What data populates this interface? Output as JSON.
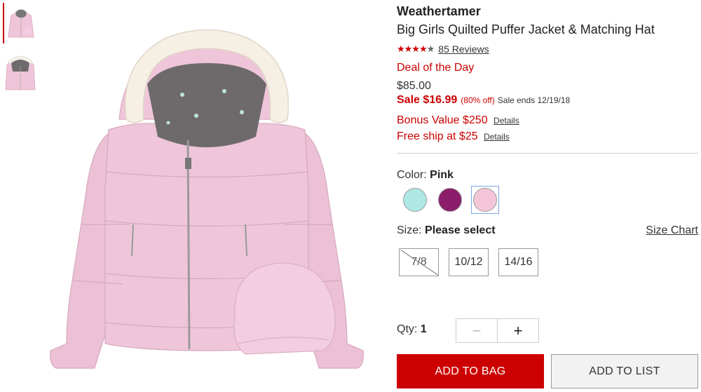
{
  "product": {
    "brand": "Weathertamer",
    "title": "Big Girls Quilted Puffer Jacket & Matching Hat",
    "rating_stars": "★★★★",
    "rating_empty_star": "★",
    "reviews_label": "85 Reviews",
    "deal_label": "Deal of the Day",
    "regular_price": "$85.00",
    "sale_price": "Sale $16.99",
    "sale_off": "(80% off)",
    "sale_ends": "Sale ends 12/19/18",
    "bonus_text": "Bonus Value $250",
    "ship_text": "Free ship at $25",
    "details_label": "Details"
  },
  "thumbnails": [
    {
      "icon": "jacket-front-thumbnail"
    },
    {
      "icon": "jacket-lining-thumbnail"
    }
  ],
  "color": {
    "label": "Color:",
    "selected": "Pink",
    "swatches": [
      {
        "name": "aqua",
        "color": "#aee8e4"
      },
      {
        "name": "purple",
        "color": "#8b1d6b"
      },
      {
        "name": "pink",
        "color": "#f4c6d8"
      }
    ]
  },
  "size": {
    "label": "Size:",
    "selected": "Please select",
    "chart_label": "Size Chart",
    "options": [
      {
        "label": "7/8",
        "available": false
      },
      {
        "label": "10/12",
        "available": true
      },
      {
        "label": "14/16",
        "available": true
      }
    ]
  },
  "quantity": {
    "label": "Qty:",
    "value": "1",
    "minus": "−",
    "plus": "+"
  },
  "actions": {
    "add_to_bag": "ADD TO BAG",
    "add_to_list": "ADD TO LIST"
  },
  "colors": {
    "accent": "#cc0000",
    "jacket": "#efc5d9",
    "fur": "#f6efe4",
    "lining": "#6e6a6c"
  }
}
